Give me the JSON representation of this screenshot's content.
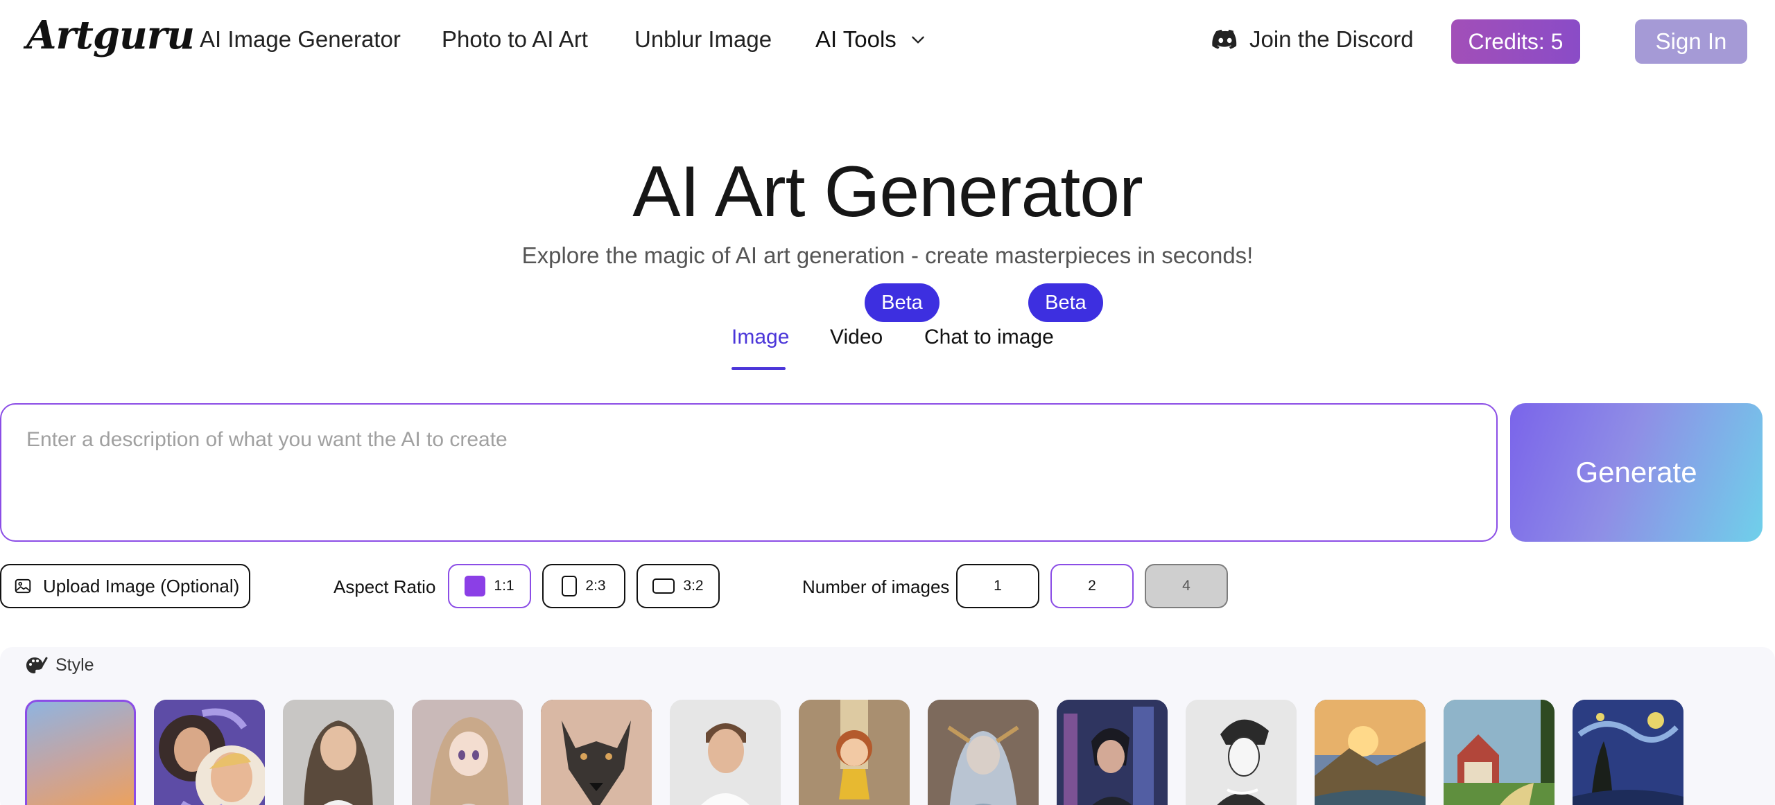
{
  "header": {
    "logo": "Artguru",
    "nav": {
      "ai_image_generator": "AI Image Generator",
      "photo_to_ai_art": "Photo to AI Art",
      "unblur_image": "Unblur Image",
      "ai_tools": "AI Tools"
    },
    "discord_label": "Join the Discord",
    "credits_label": "Credits: 5",
    "sign_in_label": "Sign In"
  },
  "hero": {
    "title": "AI Art Generator",
    "subtitle": "Explore the magic of AI art generation - create masterpieces in seconds!"
  },
  "tabs": [
    {
      "label": "Image",
      "active": true
    },
    {
      "label": "Video",
      "badge": "Beta"
    },
    {
      "label": "Chat to image",
      "badge": "Beta"
    }
  ],
  "prompt": {
    "placeholder": "Enter a description of what you want the AI to create",
    "value": ""
  },
  "generate_label": "Generate",
  "options": {
    "upload_label": "Upload Image (Optional)",
    "aspect_ratio_label": "Aspect Ratio",
    "aspect_ratios": [
      {
        "label": "1:1",
        "selected": true
      },
      {
        "label": "2:3",
        "selected": false
      },
      {
        "label": "3:2",
        "selected": false
      }
    ],
    "number_of_images_label": "Number of images",
    "counts": [
      {
        "label": "1",
        "selected": false
      },
      {
        "label": "2",
        "selected": true
      },
      {
        "label": "4",
        "disabled": true
      }
    ]
  },
  "style": {
    "label": "Style",
    "thumbnails": [
      {
        "name": "style-none",
        "selected": true
      },
      {
        "name": "style-face-swap"
      },
      {
        "name": "style-realistic-woman"
      },
      {
        "name": "style-anime"
      },
      {
        "name": "style-tattoo-wolf"
      },
      {
        "name": "style-realistic-man"
      },
      {
        "name": "style-3d-cartoon"
      },
      {
        "name": "style-fantasy-elf"
      },
      {
        "name": "style-cyberpunk"
      },
      {
        "name": "style-sketch"
      },
      {
        "name": "style-landscape"
      },
      {
        "name": "style-painting-village"
      },
      {
        "name": "style-starry-night"
      }
    ]
  },
  "colors": {
    "accent": "#4b36d9",
    "border_purple": "#8b4de6",
    "credits_bg": "#9a4ec0",
    "sign_in_bg": "#a59ad6",
    "beta_bg": "#3d2fe0"
  }
}
